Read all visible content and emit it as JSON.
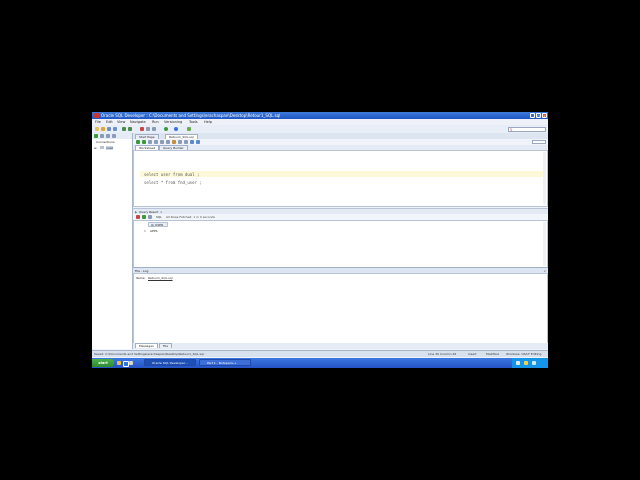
{
  "window": {
    "title": "Oracle SQL Developer : C:\\Documents and Settings\\erachaspan\\Desktop\\Retour1_SQL.sql"
  },
  "menu": [
    "File",
    "Edit",
    "View",
    "Navigate",
    "Run",
    "Versioning",
    "Tools",
    "Help"
  ],
  "left_panel": {
    "tab_label": "Connections",
    "tree_item": "oracl"
  },
  "doc_tabs": [
    "Start Page",
    "Retour1_SQL.sql"
  ],
  "worksheet_tabs": [
    "Worksheet",
    "Query Builder"
  ],
  "editor": {
    "line1": "select user from dual ;",
    "line2": "select * from fnd_user ;"
  },
  "results": {
    "tab_label": "Query Result",
    "fetched_text": "All Rows Fetched: 1 in 0 seconds",
    "sql_label": "SQL",
    "column_header": "USER",
    "row_number": "1",
    "row_value": "APPS"
  },
  "log": {
    "header": "File - Log",
    "line_label": "Items:",
    "line_value": "Retour1_SQL.sql",
    "bottom_tabs": [
      "Messages",
      "File"
    ]
  },
  "status": {
    "path": "Saved: C:\\Documents and Settings\\erachaspan\\Desktop\\Retour1_SQL.sql",
    "position": "Line 30 Column 26",
    "mode": "Insert",
    "state": "Modified",
    "platform": "Windows: CR/LF Editing"
  },
  "taskbar": {
    "start": "start",
    "tasks": [
      "Oracle SQL Developer...",
      "Part 1 - Notepad++"
    ]
  }
}
